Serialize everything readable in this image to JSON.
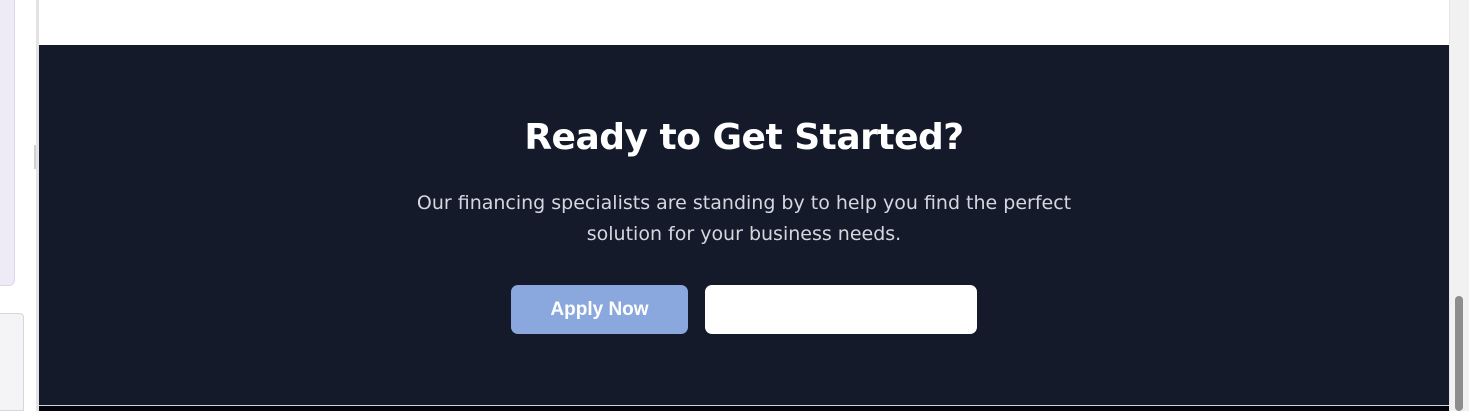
{
  "cta": {
    "title": "Ready to Get Started?",
    "subtitle": "Our financing specialists are standing by to help you find the perfect solution for your business needs.",
    "apply_button_label": "Apply Now",
    "secondary_button_label": ""
  },
  "colors": {
    "section_background": "#141a29",
    "apply_button": "#8aa8de",
    "secondary_button": "#ffffff",
    "title_text": "#ffffff",
    "subtitle_text": "#d3d7df"
  }
}
